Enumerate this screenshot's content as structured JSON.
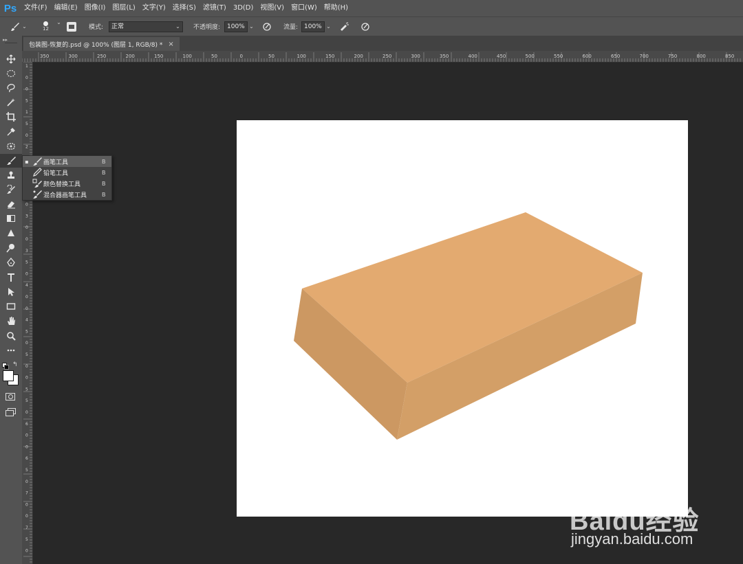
{
  "app": {
    "logo": "Ps"
  },
  "menu": [
    "文件(F)",
    "编辑(E)",
    "图像(I)",
    "图层(L)",
    "文字(Y)",
    "选择(S)",
    "滤镜(T)",
    "3D(D)",
    "视图(V)",
    "窗口(W)",
    "帮助(H)"
  ],
  "options": {
    "brush_size": "12",
    "mode_label": "模式:",
    "mode_value": "正常",
    "opacity_label": "不透明度:",
    "opacity_value": "100%",
    "flow_label": "流量:",
    "flow_value": "100%"
  },
  "document_tab": {
    "title": "包装图-恢复的.psd @ 100% (图层 1, RGB/8) *",
    "close": "×"
  },
  "ruler_top": [
    "350",
    "300",
    "250",
    "200",
    "150",
    "100",
    "50",
    "0",
    "50",
    "100",
    "150",
    "200",
    "250",
    "300",
    "350",
    "400",
    "450",
    "500",
    "550",
    "600",
    "650",
    "700",
    "750",
    "800",
    "850"
  ],
  "ruler_left": [
    "1",
    "0",
    "0",
    "5",
    "1",
    "5",
    "0",
    "2",
    "0",
    "0",
    "2",
    "5",
    "0",
    "3",
    "0",
    "0",
    "3",
    "5",
    "0",
    "4",
    "0",
    "0",
    "4",
    "5",
    "0",
    "5",
    "0",
    "0",
    "5",
    "5",
    "0",
    "6",
    "0",
    "0",
    "6",
    "5",
    "0",
    "7",
    "0",
    "0",
    "7",
    "5",
    "0"
  ],
  "flyout": {
    "items": [
      {
        "label": "画笔工具",
        "key": "B",
        "icon": "brush-icon",
        "active": true
      },
      {
        "label": "铅笔工具",
        "key": "B",
        "icon": "pencil-icon",
        "active": false
      },
      {
        "label": "颜色替换工具",
        "key": "B",
        "icon": "color-replace-icon",
        "active": false
      },
      {
        "label": "混合器画笔工具",
        "key": "B",
        "icon": "mixer-brush-icon",
        "active": false
      }
    ]
  },
  "tools": [
    "move-icon",
    "marquee-icon",
    "lasso-icon",
    "magic-wand-icon",
    "crop-icon",
    "eyedropper-icon",
    "patch-icon",
    "brush-icon",
    "stamp-icon",
    "history-brush-icon",
    "eraser-icon",
    "gradient-icon",
    "blur-icon",
    "dodge-icon",
    "pen-icon",
    "type-icon",
    "path-select-icon",
    "rectangle-icon",
    "hand-icon",
    "zoom-icon",
    "more-icon"
  ],
  "colors": {
    "box_top": "#e3aa70",
    "box_side": "#cc9862",
    "box_front": "#d39f67",
    "canvas": "#ffffff"
  },
  "watermark": {
    "logo": "Baidu经验",
    "url": "jingyan.baidu.com"
  }
}
